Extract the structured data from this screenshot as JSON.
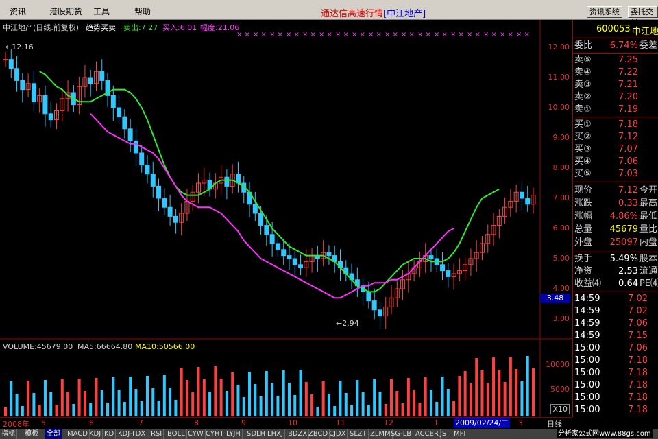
{
  "menu": {
    "items": [
      "资讯",
      "港股期货",
      "工具",
      "帮助"
    ],
    "title": "通达信高速行情",
    "title_stock": "[中江地产]",
    "btn_news": "资讯系统",
    "btn_trade": "委托交易"
  },
  "chart_header": {
    "stock": "中江地产(日线.前复权)",
    "indicator": "趋势买卖",
    "sell": "卖出:7.27",
    "buy": "买入:6.01",
    "amplitude": "幅度:21.06",
    "high_marker": "12.16",
    "low_marker": "2.94"
  },
  "volume_header": {
    "volume": "VOLUME:45679.00",
    "ma5": "MA5:66664.80",
    "ma10": "MA10:50566.00"
  },
  "price_axis": [
    "12.00",
    "11.00",
    "10.00",
    "9.00",
    "8.00",
    "7.00",
    "6.00",
    "5.00",
    "4.00",
    "3.00"
  ],
  "price_axis_current": "3.48",
  "volume_axis": [
    "10000",
    "5000",
    "X10"
  ],
  "date_axis": {
    "labels": [
      "2008年",
      "5",
      "6",
      "7",
      "8",
      "9",
      "10",
      "11",
      "12",
      "1",
      "3"
    ],
    "highlight": "2009/02/24/二",
    "period": "日线"
  },
  "bottom_tabs": [
    "指标",
    "模板",
    "全部",
    "MACD",
    "KDJ",
    "KD",
    "KDJ-TDX",
    "RSI",
    "BOLL",
    "CYW",
    "CYHT",
    "LYJH",
    "SDLH",
    "LHXJ",
    "BDZX",
    "ZBCD",
    "CJDX",
    "SLZT",
    "ZLMM",
    "SG-LB",
    "ACCER",
    "JS",
    "MFI"
  ],
  "footer_url": "分析家公式网www.88gs.com",
  "quote": {
    "code": "600053",
    "name": "中江地",
    "weibi_label": "委比",
    "weibi": "6.74%",
    "weicha_label": "委差",
    "asks": [
      {
        "label": "卖⑤",
        "price": "7.25"
      },
      {
        "label": "卖④",
        "price": "7.22"
      },
      {
        "label": "卖③",
        "price": "7.21"
      },
      {
        "label": "卖②",
        "price": "7.20"
      },
      {
        "label": "卖①",
        "price": "7.19"
      }
    ],
    "bids": [
      {
        "label": "买①",
        "price": "7.18"
      },
      {
        "label": "买②",
        "price": "7.12"
      },
      {
        "label": "买③",
        "price": "7.07"
      },
      {
        "label": "买④",
        "price": "7.06"
      },
      {
        "label": "买⑤",
        "price": "7.03"
      }
    ],
    "stats": [
      {
        "label": "现价",
        "value": "7.12",
        "label2": "今开",
        "color": "red"
      },
      {
        "label": "涨跌",
        "value": "0.33",
        "label2": "最高",
        "color": "red"
      },
      {
        "label": "涨幅",
        "value": "4.86%",
        "label2": "最低",
        "color": "red"
      },
      {
        "label": "总量",
        "value": "45679",
        "label2": "量比",
        "color": "yellow"
      },
      {
        "label": "外盘",
        "value": "25097",
        "label2": "内盘",
        "color": "red"
      }
    ],
    "stats2": [
      {
        "label": "换手",
        "value": "5.49%",
        "label2": "股本",
        "color": "white"
      },
      {
        "label": "净资",
        "value": "2.53",
        "label2": "流通",
        "color": "white"
      },
      {
        "label": "收益⑷",
        "value": "0.64",
        "label2": "PE⑷",
        "color": "white"
      }
    ],
    "ticks": [
      {
        "time": "14:59",
        "price": "7.02"
      },
      {
        "time": "14:59",
        "price": "7.02"
      },
      {
        "time": "14:59",
        "price": "7.06"
      },
      {
        "time": "14:59",
        "price": "7.15"
      },
      {
        "time": "15:00",
        "price": "7.06"
      },
      {
        "time": "15:00",
        "price": "7.18"
      },
      {
        "time": "15:00",
        "price": "7.18"
      },
      {
        "time": "15:00",
        "price": "7.18"
      },
      {
        "time": "15:00",
        "price": "7.18"
      },
      {
        "time": "15:00",
        "price": "7.18"
      }
    ]
  },
  "chart_series": {
    "close": [
      11.6,
      11.3,
      10.9,
      10.6,
      10.8,
      10.2,
      10.4,
      9.8,
      9.6,
      9.9,
      10.3,
      10.5,
      10.1,
      10.7,
      11.0,
      10.8,
      11.2,
      10.9,
      10.4,
      10.0,
      9.7,
      9.3,
      8.9,
      8.5,
      8.1,
      7.8,
      7.4,
      7.0,
      6.7,
      6.4,
      6.2,
      6.5,
      6.9,
      7.2,
      7.5,
      7.6,
      7.3,
      7.5,
      7.7,
      7.4,
      7.8,
      7.5,
      7.2,
      6.8,
      6.5,
      6.1,
      5.8,
      5.5,
      5.3,
      5.1,
      5.0,
      4.8,
      4.7,
      4.9,
      5.1,
      5.0,
      5.2,
      5.1,
      4.9,
      4.7,
      4.5,
      4.3,
      4.1,
      3.9,
      3.6,
      3.3,
      3.1,
      3.4,
      3.7,
      4.0,
      4.3,
      4.5,
      4.7,
      4.9,
      5.1,
      5.0,
      4.8,
      4.6,
      4.4,
      4.5,
      4.6,
      4.8,
      5.0,
      5.2,
      5.5,
      5.8,
      6.1,
      6.4,
      6.7,
      6.9,
      7.2,
      7.0,
      6.8,
      7.1
    ],
    "ma_green": [
      11.2,
      11.1,
      10.9,
      10.7,
      10.6,
      10.4,
      10.3,
      10.2,
      10.2,
      10.2,
      10.3,
      10.4,
      10.5,
      10.6,
      10.6,
      10.6,
      10.5,
      10.3,
      10.0,
      9.6,
      9.1,
      8.6,
      8.1,
      7.7,
      7.4,
      7.2,
      7.1,
      7.1,
      7.1,
      7.2,
      7.3,
      7.5,
      7.6,
      7.6,
      7.6,
      7.5,
      7.4,
      7.2,
      6.9,
      6.6,
      6.3,
      6.0,
      5.8,
      5.6,
      5.4,
      5.3,
      5.2,
      5.1,
      5.1,
      5.1,
      5.1,
      5.0,
      4.9,
      4.7,
      4.5,
      4.3,
      4.1,
      4.0,
      3.9,
      3.9,
      4.0,
      4.2,
      4.4,
      4.6,
      4.8,
      4.9,
      5.0,
      5.0,
      5.0,
      4.9,
      4.9,
      4.9,
      5.0,
      5.2,
      5.5,
      5.9,
      6.3,
      6.7,
      7.0,
      7.1,
      7.2,
      7.3
    ],
    "ma_magenta": [
      9.8,
      9.6,
      9.4,
      9.2,
      9.1,
      9.0,
      8.9,
      8.8,
      8.8,
      8.7,
      8.6,
      8.5,
      8.3,
      8.0,
      7.7,
      7.4,
      7.1,
      6.9,
      6.8,
      6.7,
      6.7,
      6.7,
      6.6,
      6.5,
      6.3,
      6.1,
      5.9,
      5.6,
      5.4,
      5.2,
      5.0,
      4.9,
      4.8,
      4.7,
      4.6,
      4.5,
      4.4,
      4.3,
      4.2,
      4.1,
      4.0,
      3.9,
      3.8,
      3.7,
      3.7,
      3.8,
      3.9,
      4.0,
      4.1,
      4.1,
      4.2,
      4.2,
      4.2,
      4.3,
      4.3,
      4.4,
      4.5,
      4.7,
      4.9,
      5.1,
      5.3,
      5.5,
      5.7,
      5.9,
      6.0
    ]
  }
}
